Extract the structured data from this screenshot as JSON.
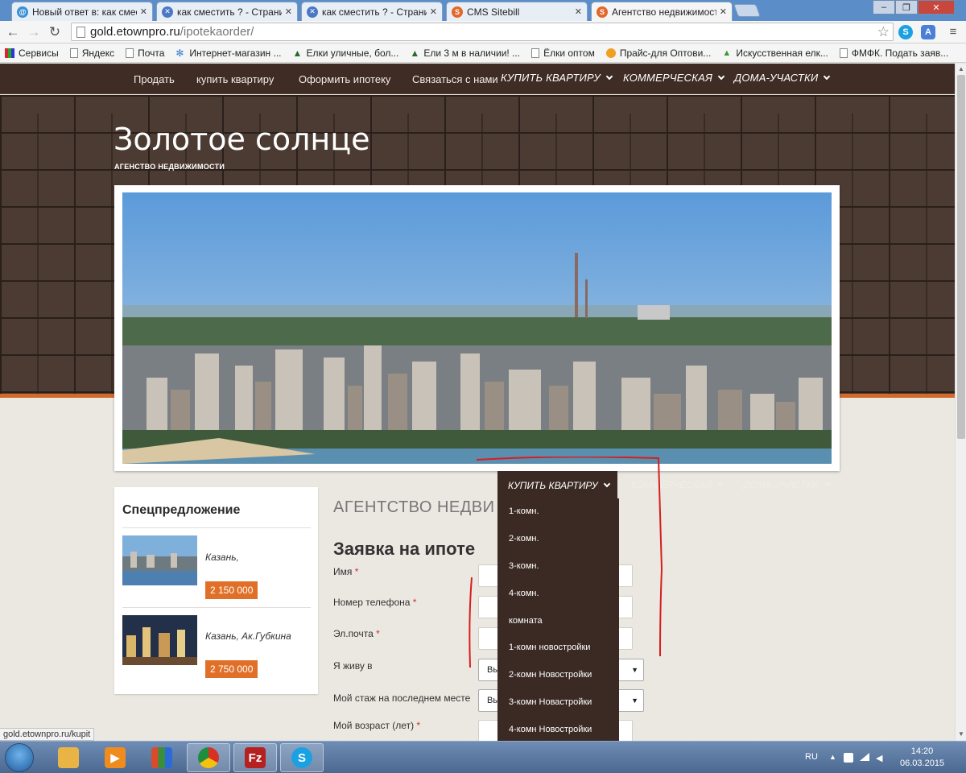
{
  "browser": {
    "tabs": [
      {
        "label": "Новый ответ в: как смести",
        "icon": "at-icon",
        "color": "#3a8fd6"
      },
      {
        "label": "как сместить ? - Страниц",
        "icon": "joomla-forum-icon",
        "color": "#4a78c4"
      },
      {
        "label": "как сместить ? - Страниц",
        "icon": "joomla-forum-icon",
        "color": "#4a78c4"
      },
      {
        "label": "CMS Sitebill",
        "icon": "sitebill-icon",
        "color": "#e2682a"
      },
      {
        "label": "Агентство недвижимост",
        "icon": "sitebill-icon",
        "color": "#e2682a"
      }
    ],
    "window_controls": [
      "–",
      "❐",
      "✕"
    ],
    "address": {
      "host": "gold.etownpro.ru",
      "path": "/ipotekaorder/"
    },
    "bookmarks": [
      {
        "label": "Сервисы",
        "icon": "apps-grid-icon"
      },
      {
        "label": "Яндекс",
        "icon": "page-icon"
      },
      {
        "label": "Почта",
        "icon": "page-icon"
      },
      {
        "label": "Интернет-магазин ...",
        "icon": "snowflake-icon"
      },
      {
        "label": "Елки уличные, бол...",
        "icon": "tree-icon"
      },
      {
        "label": "Ели 3 м в наличии! ...",
        "icon": "tree-icon"
      },
      {
        "label": "Ёлки оптом",
        "icon": "page-icon"
      },
      {
        "label": "Прайс-для Оптови...",
        "icon": "at-icon"
      },
      {
        "label": "Искусственная елк...",
        "icon": "triangle-icon"
      },
      {
        "label": "ФМФК. Подать заяв...",
        "icon": "page-icon"
      }
    ],
    "status_url": "gold.etownpro.ru/kupit"
  },
  "site": {
    "topnav": {
      "links": [
        "Продать",
        "купить квартиру",
        "Оформить ипотеку",
        "Связаться с нами"
      ],
      "menus": [
        "Купить квартиру",
        "Коммерческая",
        "Дома-участки"
      ]
    },
    "title": "Золотое солнце",
    "subtitle": "АГЕНСТВО НЕДВИЖИМОСТИ",
    "subnav": [
      "Купить квартиру",
      "Коммерческая",
      "Дома-участки"
    ],
    "sidebar": {
      "title": "Спецпредложение",
      "offers": [
        {
          "text": "Казань,",
          "price": "2 150 000"
        },
        {
          "text": "Казань, Ак.Губкина",
          "price": "2 750 000"
        }
      ]
    },
    "main_heading": "АГЕНТСТВО НЕДВИ",
    "form": {
      "title": "Заявка на ипоте",
      "fields": [
        {
          "label": "Имя",
          "required": "*",
          "type": "input"
        },
        {
          "label": "Номер телефона",
          "required": "*",
          "type": "input"
        },
        {
          "label": "Эл.почта",
          "required": "*",
          "type": "input"
        },
        {
          "label": "Я живу в",
          "required": "",
          "type": "select",
          "value": "Вы"
        },
        {
          "label": "Мой стаж на последнем месте",
          "required": "",
          "type": "select",
          "value": "Вы"
        },
        {
          "label": "Мой возраст (лет)",
          "required": "*",
          "type": "input"
        }
      ]
    },
    "dropdown": {
      "header": "Купить квартиру",
      "items": [
        "1-комн.",
        "2-комн.",
        "3-комн.",
        "4-комн.",
        "комната",
        "1-комн новостройки",
        "2-комн Новостройки",
        "3-комн Новастройки",
        "4-комн Новостройки"
      ]
    },
    "colors": {
      "nav_bg": "#3e2c25",
      "accent": "#e07028",
      "dropdown_bg": "#3b2a23"
    }
  },
  "taskbar": {
    "apps": [
      {
        "icon": "file-explorer-icon",
        "color": "#e8b445"
      },
      {
        "icon": "media-player-icon",
        "color": "#f08c1e"
      },
      {
        "icon": "apps-tiles-icon",
        "color": "#d94b2c"
      },
      {
        "icon": "chrome-icon",
        "color": "#3a8f3a"
      },
      {
        "icon": "filezilla-icon",
        "color": "#b52121"
      },
      {
        "icon": "skype-icon",
        "color": "#1ba1e2"
      }
    ],
    "lang": "RU",
    "time": "14:20",
    "date": "06.03.2015"
  }
}
